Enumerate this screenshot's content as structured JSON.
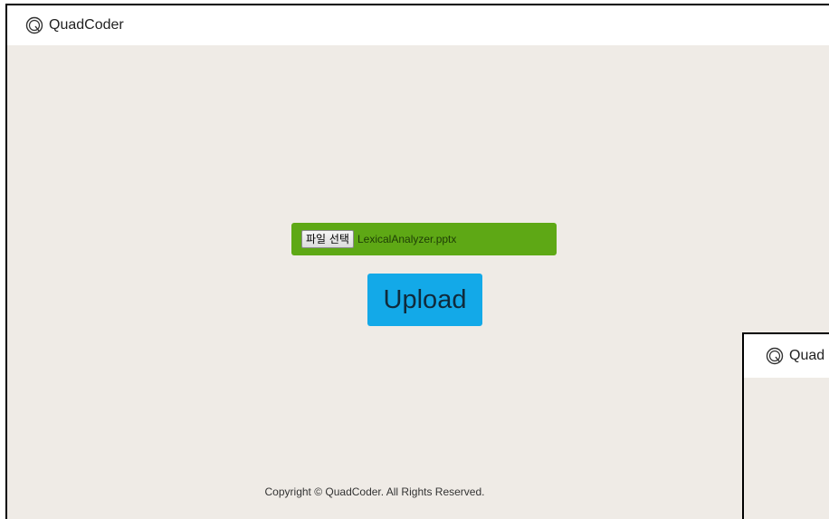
{
  "app": {
    "brand": "QuadCoder",
    "logo_icon": "quadcoder-logo-icon"
  },
  "upload_form": {
    "file_button_label": "파일 선택",
    "file_name": "LexicalAnalyzer.pptx",
    "upload_label": "Upload",
    "colors": {
      "file_bar": "#5ea815",
      "upload_button": "#13a9e8",
      "background": "#efebe6"
    }
  },
  "footer": {
    "copyright": "Copyright © QuadCoder. All Rights Reserved."
  },
  "second_window": {
    "brand_partial": "Quad"
  }
}
